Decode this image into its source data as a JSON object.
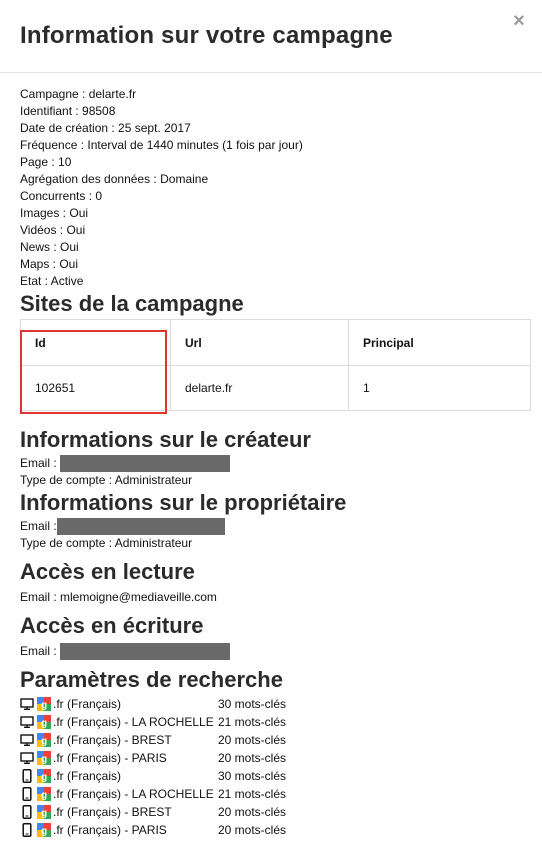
{
  "modal": {
    "title": "Information sur votre campagne",
    "close_label": "×"
  },
  "campaign_info": [
    "Campagne : delarte.fr",
    "Identifiant : 98508",
    "Date de création : 25 sept. 2017",
    "Fréquence : Interval de 1440 minutes (1 fois par jour)",
    "Page : 10",
    "Agrégation des données : Domaine",
    "Concurrents : 0",
    "Images : Oui",
    "Vidéos : Oui",
    "News : Oui",
    "Maps : Oui",
    "Etat : Active"
  ],
  "sites": {
    "title": "Sites de la campagne",
    "headers": [
      "Id",
      "Url",
      "Principal"
    ],
    "rows": [
      [
        "102651",
        "delarte.fr",
        "1"
      ]
    ]
  },
  "creator": {
    "title": "Informations sur le créateur",
    "email_label": "Email :",
    "account_type": "Type de compte : Administrateur"
  },
  "owner": {
    "title": "Informations sur le propriétaire",
    "email_label": "Email :",
    "account_type": "Type de compte : Administrateur"
  },
  "read_access": {
    "title": "Accès en lecture",
    "email": "Email : mlemoigne@mediaveille.com"
  },
  "write_access": {
    "title": "Accès en écriture",
    "email_label": "Email :"
  },
  "search_params": {
    "title": "Paramètres de recherche",
    "rows": [
      {
        "device": "desktop-icon",
        "label": ".fr (Français)",
        "count": "30 mots-clés"
      },
      {
        "device": "desktop-icon",
        "label": ".fr (Français) - LA ROCHELLE",
        "count": "21 mots-clés"
      },
      {
        "device": "desktop-icon",
        "label": ".fr (Français) - BREST",
        "count": "20 mots-clés"
      },
      {
        "device": "desktop-icon",
        "label": ".fr (Français) - PARIS",
        "count": "20 mots-clés"
      },
      {
        "device": "mobile-icon",
        "label": ".fr (Français)",
        "count": "30 mots-clés"
      },
      {
        "device": "mobile-icon",
        "label": ".fr (Français) - LA ROCHELLE",
        "count": "21 mots-clés"
      },
      {
        "device": "mobile-icon",
        "label": ".fr (Français) - BREST",
        "count": "20 mots-clés"
      },
      {
        "device": "mobile-icon",
        "label": ".fr (Français) - PARIS",
        "count": "20 mots-clés"
      }
    ]
  },
  "colors": {
    "highlight": "#e0342f",
    "redacted": "#6a6a6a",
    "title": "#2b2b2b"
  }
}
